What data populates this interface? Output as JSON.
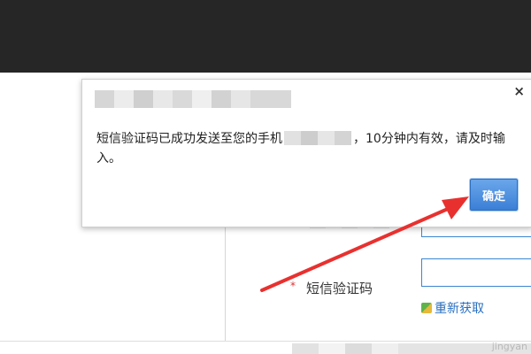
{
  "dialog": {
    "close_label": "×",
    "message_part1": "短信验证码已成功发送至您的手机",
    "message_part2": "，10分钟内有效，请及时输入。",
    "ok_label": "确定"
  },
  "form": {
    "required_mark": "*",
    "sms_code_label": "短信验证码",
    "resend_label": "重新获取"
  },
  "watermark": "jingyan",
  "colors": {
    "top_bar": "#262626",
    "accent_blue": "#3b7fd6",
    "arrow_red": "#e8312f",
    "required_red": "#e03131"
  }
}
